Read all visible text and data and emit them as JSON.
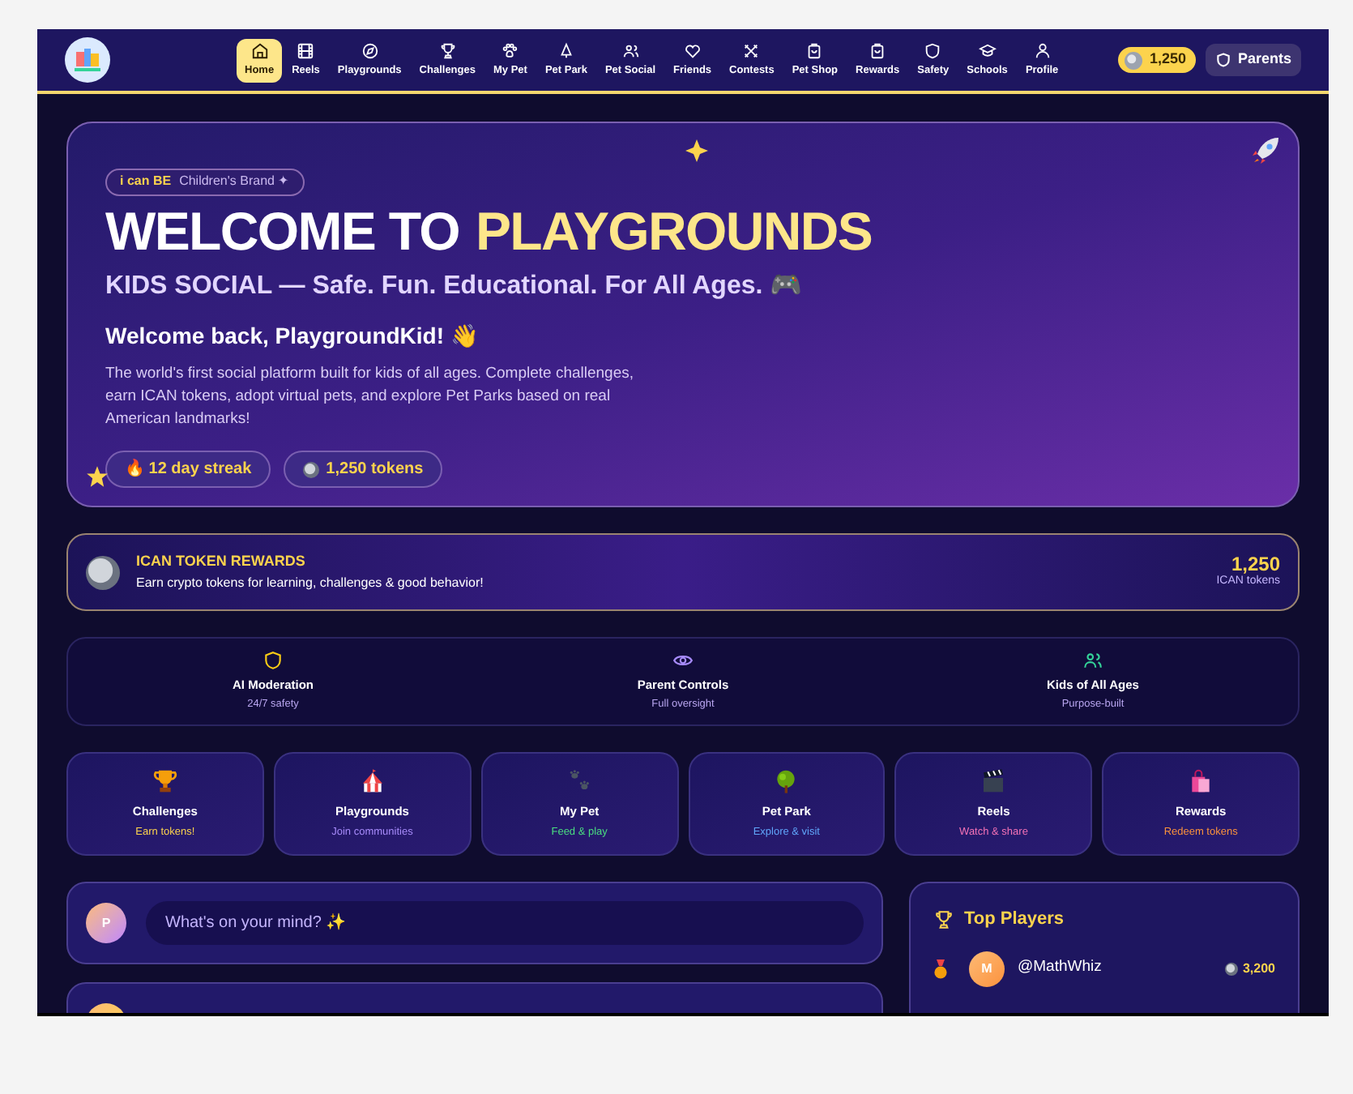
{
  "nav": {
    "items": [
      {
        "label": "Home",
        "selected": true
      },
      {
        "label": "Reels",
        "selected": false
      },
      {
        "label": "Playgrounds",
        "selected": false
      },
      {
        "label": "Challenges",
        "selected": false
      },
      {
        "label": "My Pet",
        "selected": false
      },
      {
        "label": "Pet Park",
        "selected": false
      },
      {
        "label": "Pet Social",
        "selected": false
      },
      {
        "label": "Friends",
        "selected": false
      },
      {
        "label": "Contests",
        "selected": false
      },
      {
        "label": "Pet Shop",
        "selected": false
      },
      {
        "label": "Rewards",
        "selected": false
      },
      {
        "label": "Safety",
        "selected": false
      },
      {
        "label": "Schools",
        "selected": false
      },
      {
        "label": "Profile",
        "selected": false
      }
    ],
    "tokens": "1,250",
    "parents_button": "Parents"
  },
  "hero": {
    "badge_brand": "i can BE",
    "badge_text": "Children's Brand ✦",
    "title_white": "WELCOME TO",
    "title_yellow": "PLAYGROUNDS",
    "subtitle": "KIDS SOCIAL — Safe. Fun. Educational. For All Ages. 🎮",
    "greeting": "Welcome back, PlaygroundKid! 👋",
    "description": "The world's first social platform built for kids of all ages. Complete challenges, earn ICAN tokens, adopt virtual pets, and explore Pet Parks based on real American landmarks!",
    "pills": [
      "🔥 12 day streak",
      "1,250 tokens"
    ]
  },
  "token_rewards": {
    "title": "ICAN TOKEN REWARDS",
    "subtitle": "Earn crypto tokens for learning, challenges & good behavior!",
    "amount": "1,250",
    "unit": "ICAN tokens"
  },
  "features": [
    {
      "title": "AI Moderation",
      "subtitle": "24/7 safety",
      "color": "#facc15"
    },
    {
      "title": "Parent Controls",
      "subtitle": "Full oversight",
      "color": "#a78bfa"
    },
    {
      "title": "Kids of All Ages",
      "subtitle": "Purpose-built",
      "color": "#34d399"
    }
  ],
  "tiles": [
    {
      "title": "Challenges",
      "subtitle": "Earn tokens!",
      "color": "#fcd34d"
    },
    {
      "title": "Playgrounds",
      "subtitle": "Join communities",
      "color": "#a78bfa"
    },
    {
      "title": "My Pet",
      "subtitle": "Feed & play",
      "color": "#4ade80"
    },
    {
      "title": "Pet Park",
      "subtitle": "Explore & visit",
      "color": "#60a5fa"
    },
    {
      "title": "Reels",
      "subtitle": "Watch & share",
      "color": "#f472b6"
    },
    {
      "title": "Rewards",
      "subtitle": "Redeem tokens",
      "color": "#fb923c"
    }
  ],
  "composer": {
    "avatar": "P",
    "placeholder": "What's on your mind? ✨"
  },
  "top_players": {
    "title": "Top Players",
    "rows": [
      {
        "avatar": "M",
        "name": "@MathWhiz",
        "tokens": "3,200"
      }
    ]
  }
}
